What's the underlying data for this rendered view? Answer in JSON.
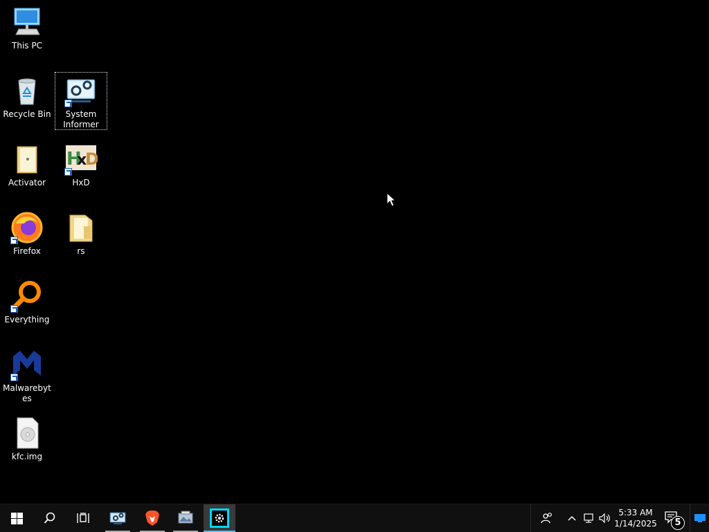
{
  "desktop": {
    "icons": [
      {
        "label": "This PC",
        "icon": "computer-icon"
      },
      {
        "label": "Recycle Bin",
        "icon": "recycle-bin-icon"
      },
      {
        "label": "System Informer",
        "icon": "system-informer-icon",
        "selected": true
      },
      {
        "label": "Activator",
        "icon": "folder-icon"
      },
      {
        "label": "HxD",
        "icon": "hxd-icon"
      },
      {
        "label": "Firefox",
        "icon": "firefox-icon"
      },
      {
        "label": "rs",
        "icon": "folder-icon"
      },
      {
        "label": "Everything",
        "icon": "everything-icon"
      },
      {
        "label": "Malwarebytes",
        "icon": "malwarebytes-icon"
      },
      {
        "label": "kfc.img",
        "icon": "disc-image-icon"
      }
    ]
  },
  "taskbar": {
    "start": "windows-start-icon",
    "search": "search-icon",
    "taskview": "task-view-icon",
    "apps": [
      {
        "icon": "system-informer-icon"
      },
      {
        "icon": "brave-icon"
      },
      {
        "icon": "screenshot-tool-icon"
      },
      {
        "icon": "settings-gear-icon",
        "active": true
      }
    ],
    "tray": {
      "time": "5:33 AM",
      "date": "1/14/2025",
      "notification_count": "5"
    }
  },
  "colors": {
    "desktop_background": "#000000",
    "taskbar_background": "#101010",
    "active_app_accent": "#4cc2ff",
    "active_app_icon_bg": "#00d8ff"
  }
}
